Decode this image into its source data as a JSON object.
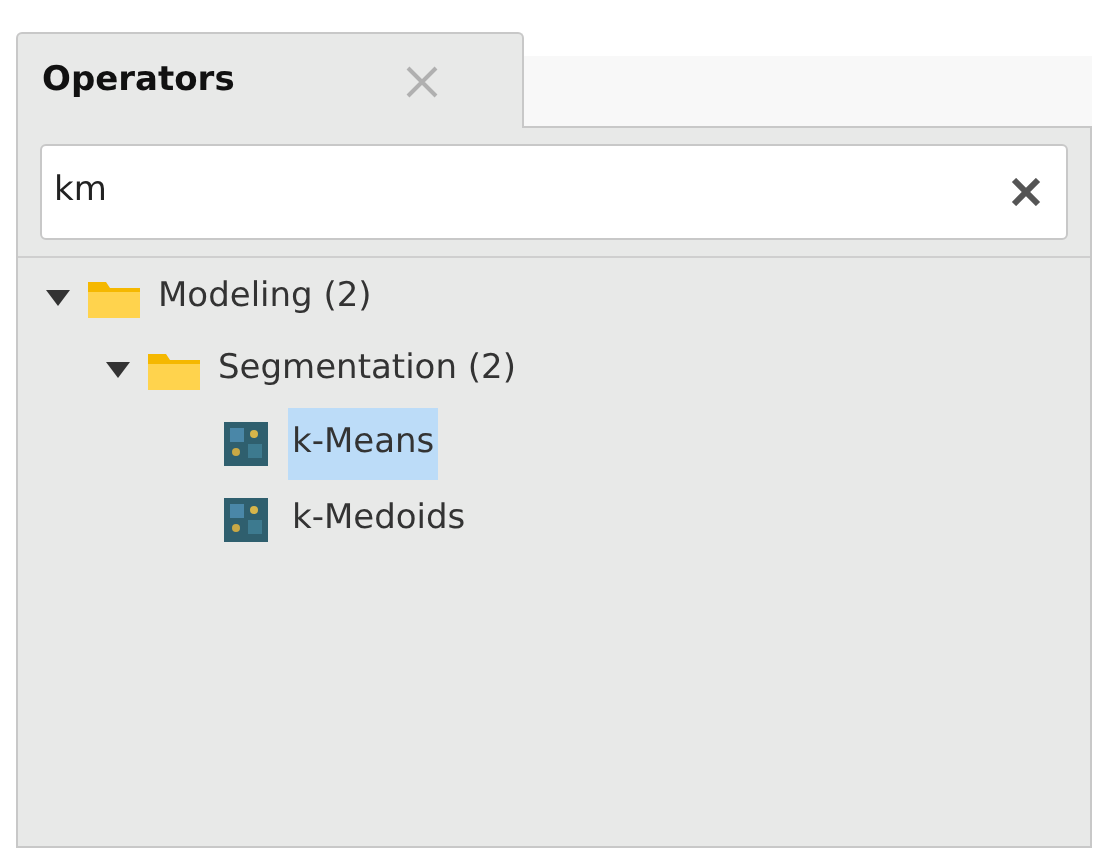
{
  "tabs": [
    {
      "label": "Operators",
      "selected": true
    }
  ],
  "search": {
    "value": "km"
  },
  "tree": [
    {
      "kind": "folder",
      "label": "Modeling (2)",
      "expanded": true,
      "children": [
        {
          "kind": "folder",
          "label": "Segmentation (2)",
          "expanded": true,
          "children": [
            {
              "kind": "operator",
              "label": "k-Means",
              "selected": true
            },
            {
              "kind": "operator",
              "label": "k-Medoids",
              "selected": false
            }
          ]
        }
      ]
    }
  ]
}
